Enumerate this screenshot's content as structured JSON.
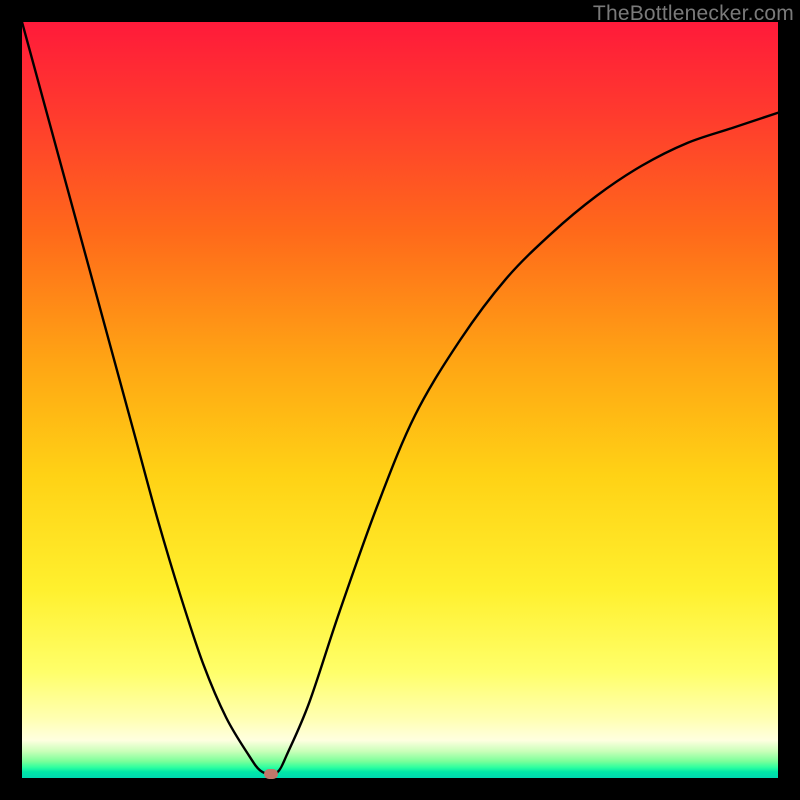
{
  "watermark": "TheBottlenecker.com",
  "chart_data": {
    "type": "line",
    "title": "",
    "xlabel": "",
    "ylabel": "",
    "xlim": [
      0,
      100
    ],
    "ylim": [
      0,
      100
    ],
    "grid": false,
    "series": [
      {
        "name": "bottleneck-curve",
        "x": [
          0,
          3,
          6,
          9,
          12,
          15,
          18,
          21,
          24,
          27,
          30,
          31.5,
          33,
          34,
          35,
          38,
          42,
          47,
          52,
          58,
          64,
          70,
          76,
          82,
          88,
          94,
          100
        ],
        "y": [
          100,
          89,
          78,
          67,
          56,
          45,
          34,
          24,
          15,
          8,
          3,
          1,
          0.5,
          1,
          3,
          10,
          22,
          36,
          48,
          58,
          66,
          72,
          77,
          81,
          84,
          86,
          88
        ]
      }
    ],
    "marker": {
      "x": 33,
      "y": 0.5,
      "color": "#c1776a"
    },
    "gradient_stops": [
      {
        "pos": 0,
        "color": "#ff1a3a"
      },
      {
        "pos": 0.28,
        "color": "#ff6a1a"
      },
      {
        "pos": 0.6,
        "color": "#ffd215"
      },
      {
        "pos": 0.92,
        "color": "#ffffb0"
      },
      {
        "pos": 1.0,
        "color": "#00d8b0"
      }
    ]
  }
}
